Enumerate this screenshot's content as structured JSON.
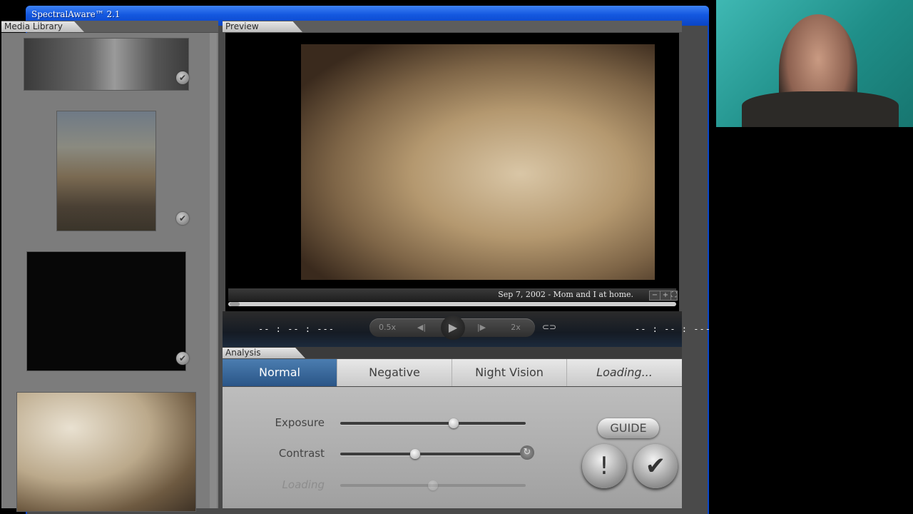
{
  "window": {
    "title": "SpectralAware™ 2.1"
  },
  "media_library": {
    "title": "Media Library",
    "thumbnails": [
      {
        "label": "photo-1",
        "checked": true
      },
      {
        "label": "photo-2",
        "checked": true
      },
      {
        "label": "photo-3",
        "checked": true
      },
      {
        "label": "photo-4",
        "checked": false
      }
    ]
  },
  "preview": {
    "title": "Preview",
    "caption": "Sep 7, 2002 - Mom and I at home.",
    "zoom_out": "−",
    "zoom_in": "+",
    "fullscreen": "⛶",
    "progress": 0
  },
  "transport": {
    "time_left": "-- : -- : ---",
    "time_right": "-- : -- : ---",
    "speed_slow": "0.5x",
    "speed_fast": "2x",
    "prev_icon": "◀|",
    "play_icon": "▶",
    "next_icon": "|▶",
    "loop_icon": "⊂⊃"
  },
  "analysis": {
    "title": "Analysis",
    "tabs": [
      {
        "label": "Normal",
        "active": true
      },
      {
        "label": "Negative",
        "active": false
      },
      {
        "label": "Night Vision",
        "active": false
      },
      {
        "label": "Loading...",
        "active": false
      }
    ],
    "sliders": [
      {
        "label": "Exposure",
        "value": 0.61,
        "enabled": true
      },
      {
        "label": "Contrast",
        "value": 0.4,
        "enabled": true
      },
      {
        "label": "Loading",
        "value": 0.5,
        "enabled": false
      }
    ],
    "reset_icon": "↻",
    "guide_label": "GUIDE",
    "alert_icon": "!",
    "confirm_icon": "✔"
  },
  "colors": {
    "titlebar": "#1458e0",
    "active_tab": "#2f5c8f",
    "panel": "#7c7c7c"
  }
}
